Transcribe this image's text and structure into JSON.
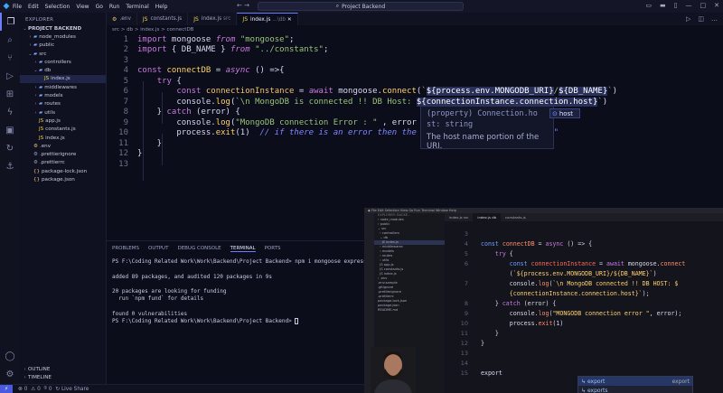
{
  "titlebar": {
    "menu": [
      "File",
      "Edit",
      "Selection",
      "View",
      "Go",
      "Run",
      "Terminal",
      "Help"
    ],
    "search": "Project Backend"
  },
  "sidebar": {
    "title": "EXPLORER",
    "project": "PROJECT BACKEND",
    "items": [
      {
        "label": "node_modules",
        "depth": 1,
        "type": "folder",
        "open": false
      },
      {
        "label": "public",
        "depth": 1,
        "type": "folder",
        "open": false
      },
      {
        "label": "src",
        "depth": 1,
        "type": "folder",
        "open": true
      },
      {
        "label": "controllers",
        "depth": 2,
        "type": "folder",
        "open": false
      },
      {
        "label": "db",
        "depth": 2,
        "type": "folder",
        "open": true
      },
      {
        "label": "index.js",
        "depth": 3,
        "type": "js",
        "selected": true
      },
      {
        "label": "middlewares",
        "depth": 2,
        "type": "folder",
        "open": false
      },
      {
        "label": "models",
        "depth": 2,
        "type": "folder",
        "open": false
      },
      {
        "label": "routes",
        "depth": 2,
        "type": "folder",
        "open": false
      },
      {
        "label": "utils",
        "depth": 2,
        "type": "folder",
        "open": false
      },
      {
        "label": "app.js",
        "depth": 2,
        "type": "js"
      },
      {
        "label": "constants.js",
        "depth": 2,
        "type": "js"
      },
      {
        "label": "index.js",
        "depth": 2,
        "type": "js"
      },
      {
        "label": ".env",
        "depth": 1,
        "type": "env"
      },
      {
        "label": ".prettierignore",
        "depth": 1,
        "type": "cfg"
      },
      {
        "label": ".prettierrc",
        "depth": 1,
        "type": "cfg"
      },
      {
        "label": "package-lock.json",
        "depth": 1,
        "type": "json"
      },
      {
        "label": "package.json",
        "depth": 1,
        "type": "json"
      }
    ],
    "outline": "OUTLINE",
    "timeline": "TIMELINE"
  },
  "tabs": [
    {
      "label": ".env",
      "icon": "env",
      "active": false
    },
    {
      "label": "constants.js",
      "icon": "js",
      "active": false
    },
    {
      "label": "index.js",
      "icon": "js",
      "active": false,
      "path": "src"
    },
    {
      "label": "index.js",
      "icon": "js",
      "active": true,
      "path": "...\\db"
    }
  ],
  "breadcrumb": "src > db > index.js > connectDB",
  "editor": {
    "line_numbers": [
      "1",
      "2",
      "3",
      "4",
      "5",
      "6",
      "7",
      "8",
      "9",
      "10",
      "11",
      "12",
      "13"
    ]
  },
  "hover": {
    "line1": "(property) Connection.ho",
    "line2": "st: string",
    "line3": "The host name portion of the URI.",
    "suggest": "host"
  },
  "panel": {
    "tabs": [
      "PROBLEMS",
      "OUTPUT",
      "DEBUG CONSOLE",
      "TERMINAL",
      "PORTS"
    ],
    "active_tab": "TERMINAL",
    "terminal": [
      "PS F:\\Coding Related Work\\Work\\Backend\\Project Backend> npm i mongoose express dotenv",
      "",
      "added 89 packages, and audited 120 packages in 9s",
      "",
      "20 packages are looking for funding",
      "  run `npm fund` for details",
      "",
      "found 0 vulnerabilities",
      "PS F:\\Coding Related Work\\Work\\Backend\\Project Backend> "
    ]
  },
  "statusbar": {
    "errors": "0",
    "warnings": "0",
    "ports": "0",
    "live_share": "Live Share"
  },
  "overlay": {
    "tabs": [
      "index.js src",
      "index.js db",
      "constants.js"
    ],
    "line_numbers": [
      "3",
      "4",
      "5",
      "6",
      "7",
      "8",
      "9",
      "10",
      "11",
      "12",
      "13",
      "14",
      "15"
    ],
    "suggestions": [
      "export",
      "exports"
    ],
    "suggestion_detail": "export",
    "typed": "export"
  }
}
